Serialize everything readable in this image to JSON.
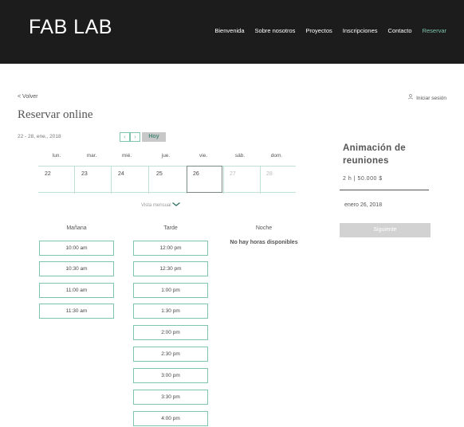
{
  "header": {
    "logo": "FAB LAB",
    "nav": [
      "Bienvenida",
      "Sobre nosotros",
      "Proyectos",
      "Inscripciones",
      "Contacto",
      "Reservar"
    ],
    "active_nav": "Reservar",
    "accent": "#7fc4ae"
  },
  "page": {
    "back": "< Volver",
    "login": "Iniciar sesión",
    "login_icon": "user-icon",
    "title": "Reservar online"
  },
  "calendar": {
    "range": "22 - 28, ene., 2018",
    "prev_icon": "chevron-left-icon",
    "next_icon": "chevron-right-icon",
    "today": "Hoy",
    "weekdays": [
      "lun.",
      "mar.",
      "mié.",
      "jue.",
      "vie.",
      "sáb.",
      "dom."
    ],
    "days": [
      "22",
      "23",
      "24",
      "25",
      "26",
      "27",
      "28"
    ],
    "selected_day": "26",
    "view_toggle": "Vista mensual"
  },
  "summary": {
    "service": "Animación de reuniones",
    "info": "2 h  |  50.000 $",
    "date": "enero 26, 2018",
    "next": "Siguiente"
  },
  "slots": {
    "morning_title": "Mañana",
    "afternoon_title": "Tarde",
    "night_title": "Noche",
    "morning": [
      "10:00 am",
      "10:30 am",
      "11:00 am",
      "11:30 am"
    ],
    "afternoon": [
      "12:00 pm",
      "12:30 pm",
      "1:00 pm",
      "1:30 pm",
      "2:00 pm",
      "2:30 pm",
      "3:00 pm",
      "3:30 pm",
      "4:00 pm"
    ],
    "night_empty": "No hay horas disponibles"
  }
}
